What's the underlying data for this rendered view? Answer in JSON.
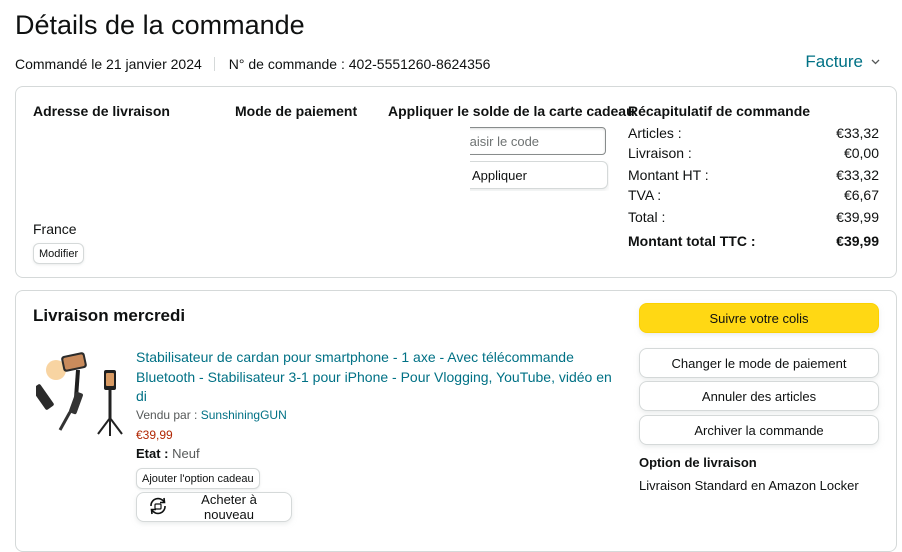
{
  "header": {
    "title": "Détails de la commande",
    "ordered_on": "Commandé le 21 janvier 2024",
    "order_number": "N° de commande : 402-5551260-8624356",
    "invoice_label": "Facture"
  },
  "summary_card": {
    "shipping_address": {
      "heading": "Adresse de livraison",
      "country": "France",
      "edit_label": "Modifier"
    },
    "payment": {
      "heading": "Mode de paiement"
    },
    "gift_card": {
      "heading": "Appliquer le solde de la carte cadeau",
      "input_placeholder": "Saisir le code",
      "apply_label": "Appliquer"
    },
    "order_summary": {
      "heading": "Récapitulatif de commande",
      "rows": [
        {
          "label": "Articles :",
          "value": "€33,32"
        },
        {
          "label": "Livraison :",
          "value": "€0,00"
        },
        {
          "label": "Montant HT :",
          "value": "€33,32"
        },
        {
          "label": "TVA :",
          "value": "€6,67"
        },
        {
          "label": "Total :",
          "value": "€39,99"
        },
        {
          "label": "Montant total TTC :",
          "value": "€39,99"
        }
      ]
    }
  },
  "delivery": {
    "heading": "Livraison mercredi",
    "product": {
      "title": "Stabilisateur de cardan pour smartphone - 1 axe - Avec télécommande Bluetooth - Stabilisateur 3-1 pour iPhone - Pour Vlogging, YouTube, vidéo en di",
      "sold_by_label": "Vendu par : ",
      "seller": "SunshiningGUN",
      "price": "€39,99",
      "condition_label": "Etat :",
      "condition_value": " Neuf",
      "gift_option_label": "Ajouter l'option cadeau",
      "rebuy_label": "Acheter à nouveau"
    },
    "actions": {
      "track": "Suivre votre colis",
      "change_payment": "Changer le mode de paiement",
      "cancel": "Annuler des articles",
      "archive": "Archiver la commande"
    },
    "shipping_option": {
      "heading": "Option de livraison",
      "value": "Livraison Standard en Amazon Locker"
    }
  },
  "colors": {
    "link": "#007185",
    "price": "#b12704",
    "primary_button": "#ffd814",
    "border": "#d5d9d9"
  },
  "icons": {
    "invoice": "chevron-down-icon",
    "rebuy": "rebuy-icon"
  }
}
